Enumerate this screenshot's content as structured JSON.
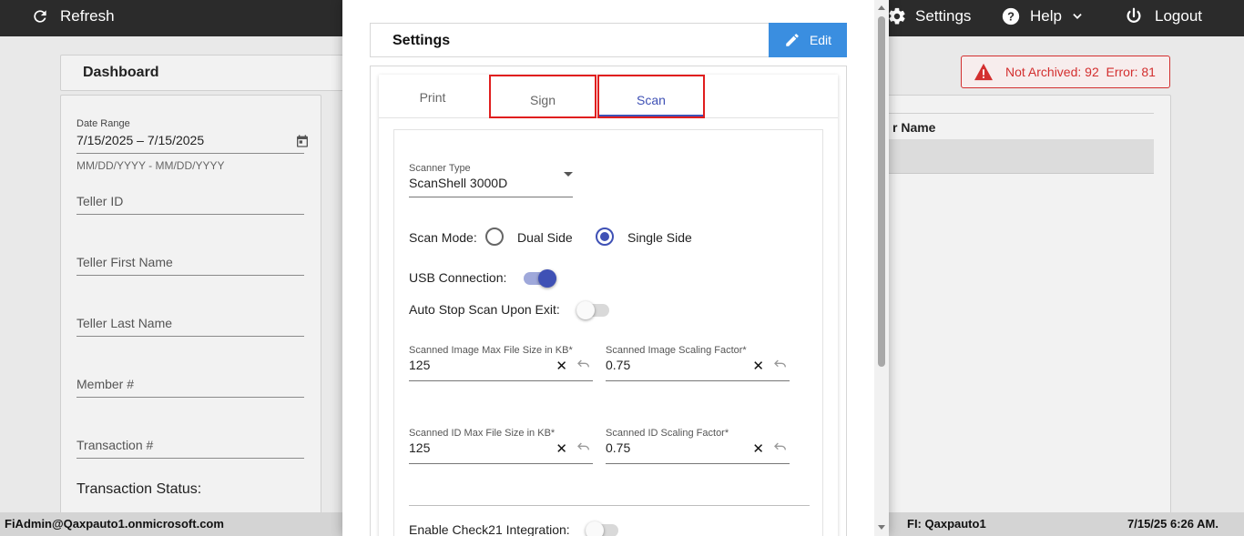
{
  "topbar": {
    "refresh_label": "Refresh",
    "settings_label": "Settings",
    "help_label": "Help",
    "logout_label": "Logout"
  },
  "dashboard": {
    "title": "Dashboard",
    "date_range_label": "Date Range",
    "date_range_value": "7/15/2025 – 7/15/2025",
    "date_range_hint": "MM/DD/YYYY - MM/DD/YYYY",
    "teller_id": "Teller ID",
    "teller_first_name": "Teller First Name",
    "teller_last_name": "Teller Last Name",
    "member_no": "Member #",
    "transaction_no": "Transaction #",
    "transaction_status": "Transaction Status:",
    "alert_text": "Not Archived: 92  Error: 81",
    "table_column_fragment": "r Name",
    "alert_color": "#d32f2f"
  },
  "statusbar": {
    "user": "FiAdmin@Qaxpauto1.onmicrosoft.com",
    "fi": "FI: Qaxpauto1",
    "datetime": "7/15/25 6:26 AM."
  },
  "modal": {
    "title": "Settings",
    "edit_label": "Edit",
    "tabs": [
      {
        "label": "Print",
        "active": false
      },
      {
        "label": "Sign",
        "active": false
      },
      {
        "label": "Scan",
        "active": true
      }
    ],
    "scanner_type_label": "Scanner Type",
    "scanner_type_value": "ScanShell 3000D",
    "scan_mode_label": "Scan Mode:",
    "scan_mode_options": [
      {
        "label": "Dual Side",
        "selected": false
      },
      {
        "label": "Single Side",
        "selected": true
      }
    ],
    "usb_connection_label": "USB Connection:",
    "usb_connection_on": true,
    "auto_stop_label": "Auto Stop Scan Upon Exit:",
    "auto_stop_on": false,
    "fields": [
      {
        "label": "Scanned Image Max File Size in KB*",
        "value": "125"
      },
      {
        "label": "Scanned Image Scaling Factor*",
        "value": "0.75"
      },
      {
        "label": "Scanned ID Max File Size in KB*",
        "value": "125"
      },
      {
        "label": "Scanned ID Scaling Factor*",
        "value": "0.75"
      }
    ],
    "check21_label": "Enable Check21 Integration:",
    "check21_on": false,
    "accent_color": "#3f51b5",
    "edit_button_color": "#3a8ee0",
    "highlight_color": "#e01e1e"
  }
}
